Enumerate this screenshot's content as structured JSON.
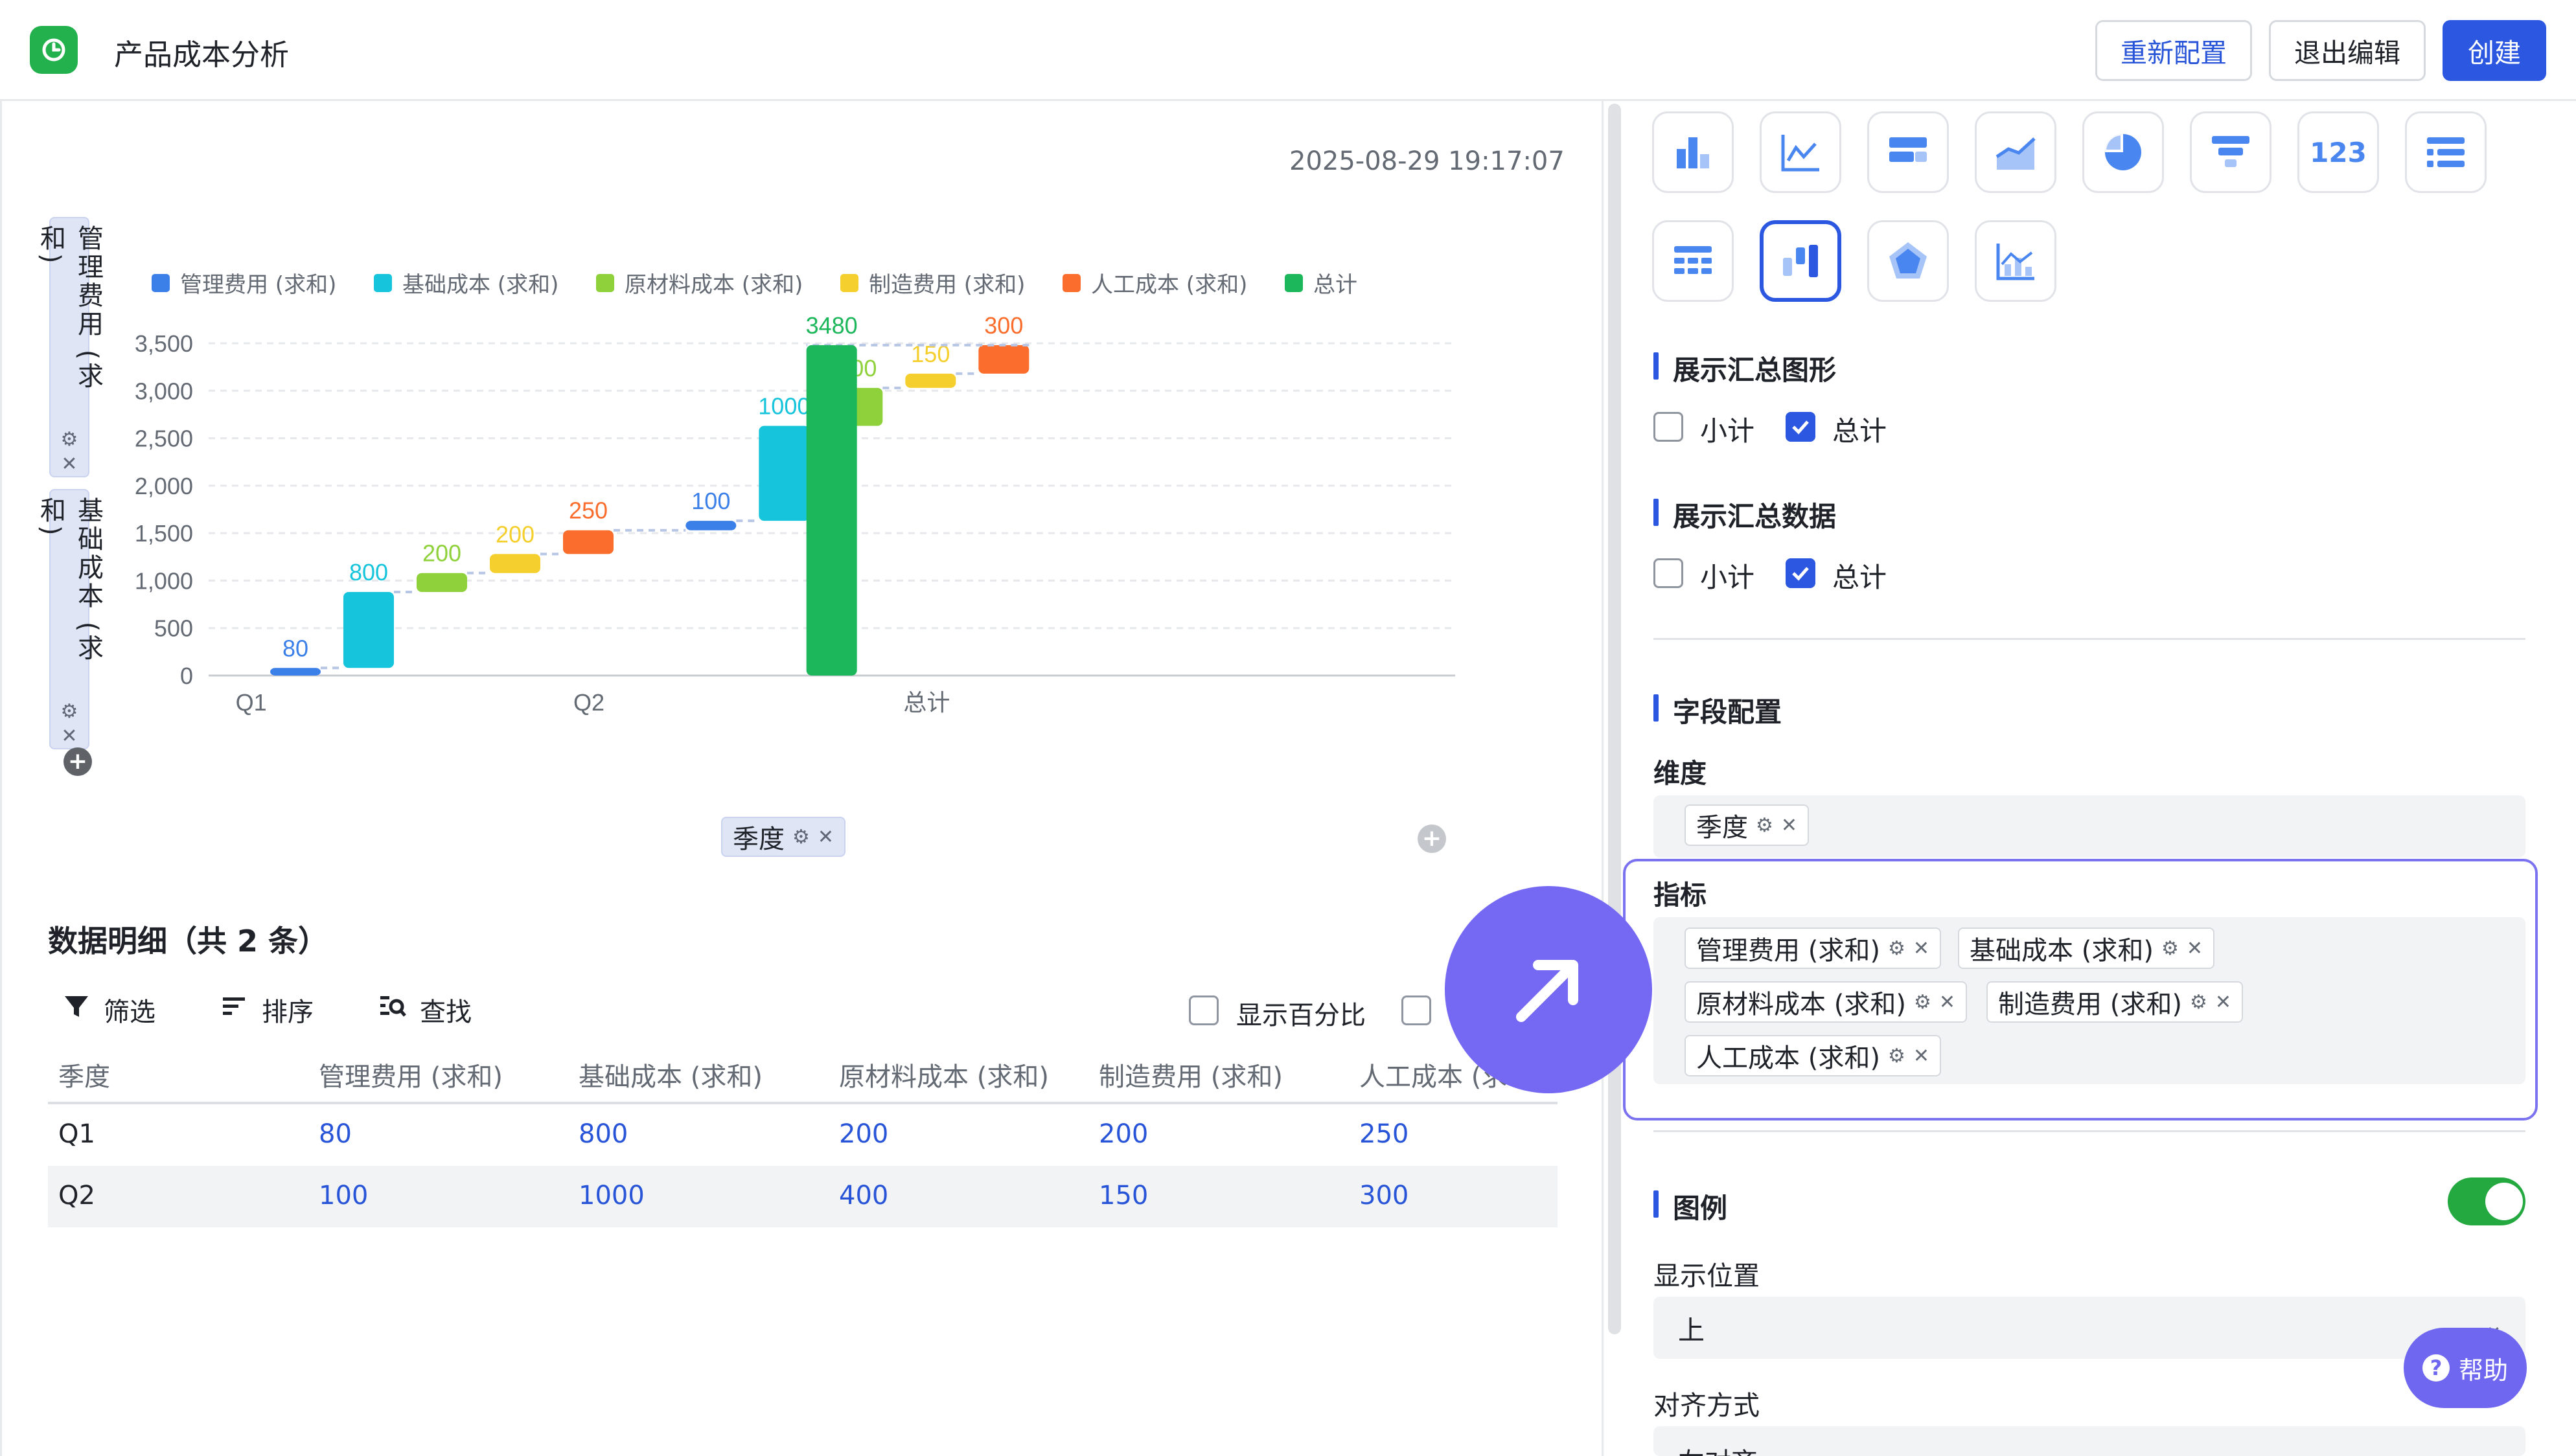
{
  "header": {
    "title": "产品成本分析",
    "reconfig_label": "重新配置",
    "exit_label": "退出编辑",
    "create_label": "创建",
    "accent": "#2c57e0",
    "logo_color": "#22b14c"
  },
  "chart_panel": {
    "timestamp": "2025-08-29 19:17:07",
    "y_fields": [
      "管理费用 (求和)",
      "基础成本 (求和)"
    ],
    "x_field": "季度",
    "gear_icon": "gear-icon",
    "close_icon": "close-icon"
  },
  "chart_data": {
    "type": "bar",
    "subtype": "waterfall",
    "categories": [
      "Q1",
      "Q2",
      "总计"
    ],
    "series": [
      {
        "name": "管理费用 (求和)",
        "color": "#3b7fe8",
        "values": [
          80,
          100
        ]
      },
      {
        "name": "基础成本 (求和)",
        "color": "#16c4db",
        "values": [
          800,
          1000
        ]
      },
      {
        "name": "原材料成本 (求和)",
        "color": "#8fd13a",
        "values": [
          200,
          400
        ]
      },
      {
        "name": "制造费用 (求和)",
        "color": "#f5cf2d",
        "values": [
          200,
          150
        ]
      },
      {
        "name": "人工成本 (求和)",
        "color": "#fa6d2c",
        "values": [
          250,
          300
        ]
      },
      {
        "name": "总计",
        "color": "#1db75b",
        "values": [
          3480
        ]
      }
    ],
    "data_labels": [
      "80",
      "800",
      "200",
      "200",
      "250",
      "100",
      "1000",
      "400",
      "150",
      "300",
      "3480"
    ],
    "y_ticks": [
      "0",
      "500",
      "1,000",
      "1,500",
      "2,000",
      "2,500",
      "3,000",
      "3,500"
    ],
    "ylim": [
      0,
      3500
    ],
    "legend_position": "top",
    "grid": true
  },
  "detail": {
    "title": "数据明细（共 2 条）",
    "filter_label": "筛选",
    "sort_label": "排序",
    "find_label": "查找",
    "show_percent_label": "显示百分比",
    "columns": [
      "季度",
      "管理费用 (求和)",
      "基础成本 (求和)",
      "原材料成本 (求和)",
      "制造费用 (求和)",
      "人工成本 (求"
    ],
    "rows": [
      [
        "Q1",
        "80",
        "800",
        "200",
        "200",
        "250"
      ],
      [
        "Q2",
        "100",
        "1000",
        "400",
        "150",
        "300"
      ]
    ]
  },
  "config": {
    "chart_types": [
      "bar-chart-icon",
      "line-chart-icon",
      "horizontal-bar-icon",
      "area-chart-icon",
      "pie-chart-icon",
      "funnel-chart-icon",
      "number-card-icon",
      "list-icon",
      "table-icon",
      "waterfall-chart-icon",
      "radar-chart-icon",
      "combo-chart-icon"
    ],
    "number_card_text": "123",
    "summary_graph_title": "展示汇总图形",
    "summary_data_title": "展示汇总数据",
    "subtotal_label": "小计",
    "total_label": "总计",
    "field_config_title": "字段配置",
    "dimension_label": "维度",
    "dimension_tag": "季度",
    "metric_label": "指标",
    "metric_tags": [
      "管理费用 (求和)",
      "基础成本 (求和)",
      "原材料成本 (求和)",
      "制造费用 (求和)",
      "人工成本 (求和)"
    ],
    "legend_title": "图例",
    "legend_position_label": "显示位置",
    "legend_position_value": "上",
    "align_label": "对齐方式",
    "align_value": "左对齐"
  },
  "help_label": "帮助"
}
